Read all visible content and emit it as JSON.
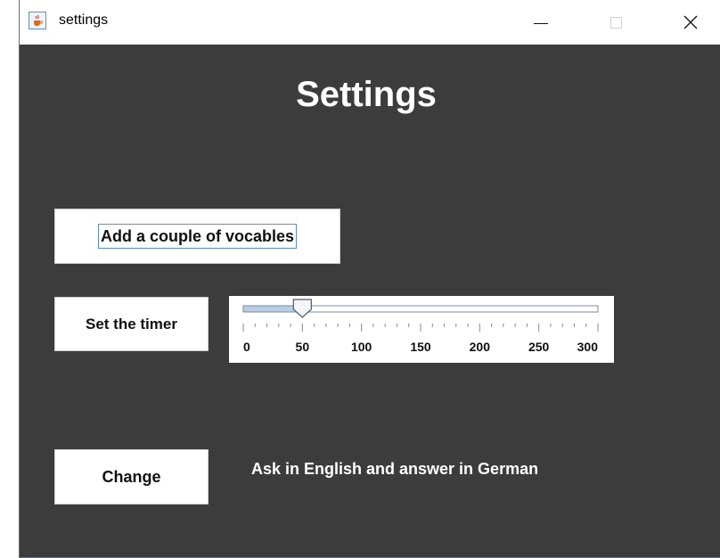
{
  "window": {
    "title": "settings",
    "icon": "java-cup-icon"
  },
  "heading": "Settings",
  "buttons": {
    "vocabulary": "Add a couple of vocables",
    "timer": "Set the timer",
    "change": "Change"
  },
  "slider": {
    "min": 0,
    "max": 300,
    "value": 50,
    "major_tick_spacing": 50,
    "minor_tick_spacing": 10,
    "labels": [
      "0",
      "50",
      "100",
      "150",
      "200",
      "250",
      "300"
    ]
  },
  "mode_label": "Ask in English and answer in German",
  "colors": {
    "background": "#3c3c3c",
    "accent": "#5b8fc7"
  }
}
